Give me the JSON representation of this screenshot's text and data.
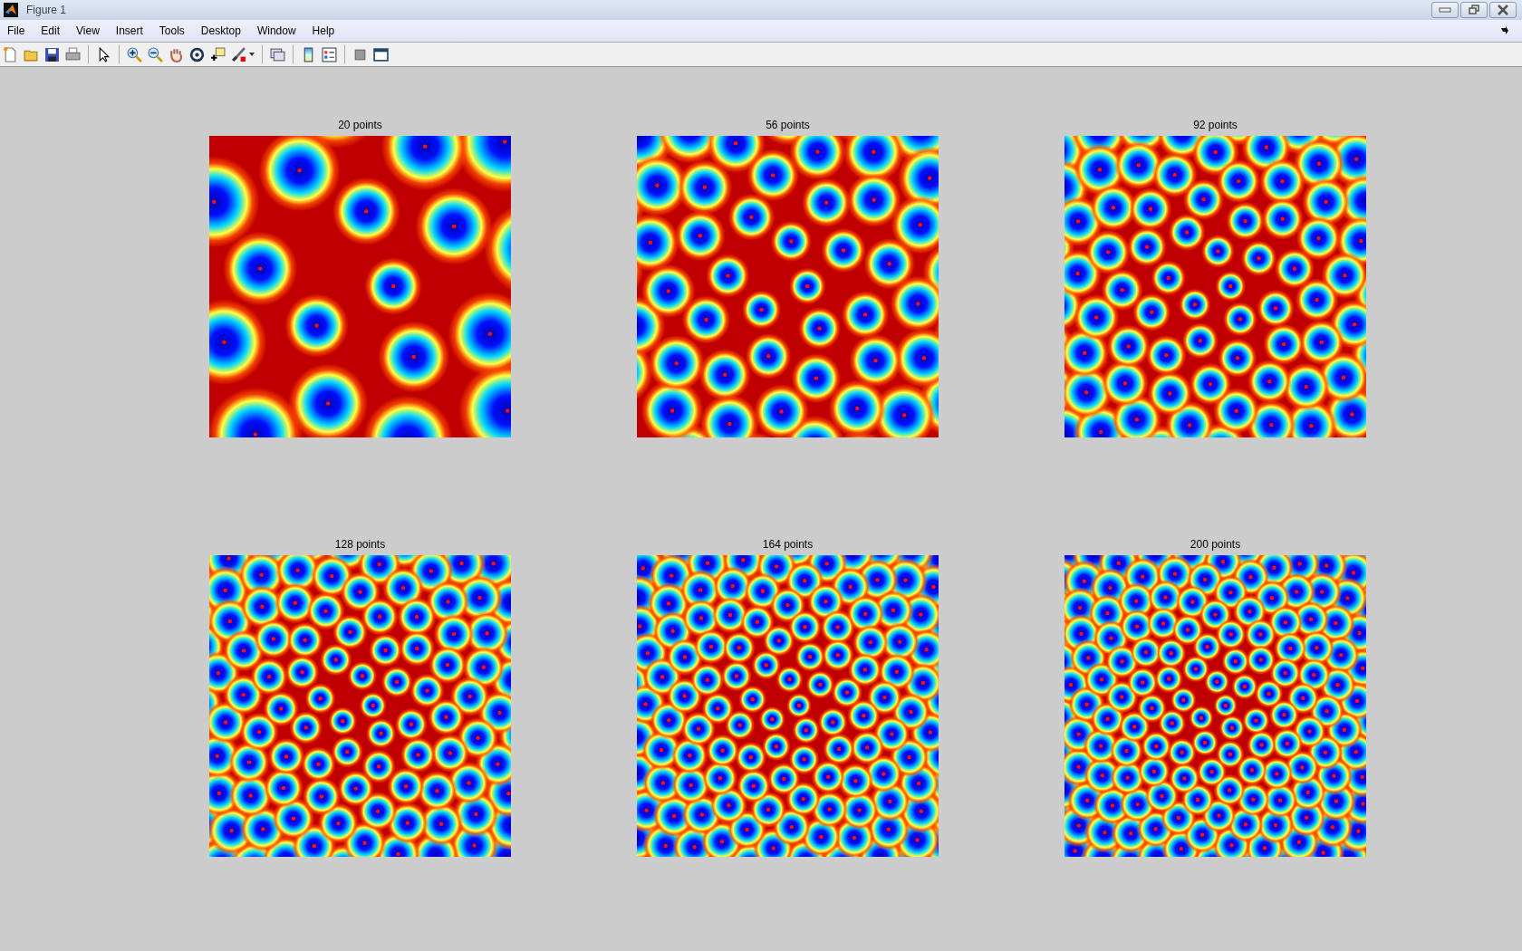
{
  "window": {
    "title": "Figure 1"
  },
  "menu": [
    "File",
    "Edit",
    "View",
    "Insert",
    "Tools",
    "Desktop",
    "Window",
    "Help"
  ],
  "plots": [
    {
      "title": "20 points"
    },
    {
      "title": "56 points"
    },
    {
      "title": "92 points"
    },
    {
      "title": "128 points"
    },
    {
      "title": "164 points"
    },
    {
      "title": "200 points"
    }
  ]
}
